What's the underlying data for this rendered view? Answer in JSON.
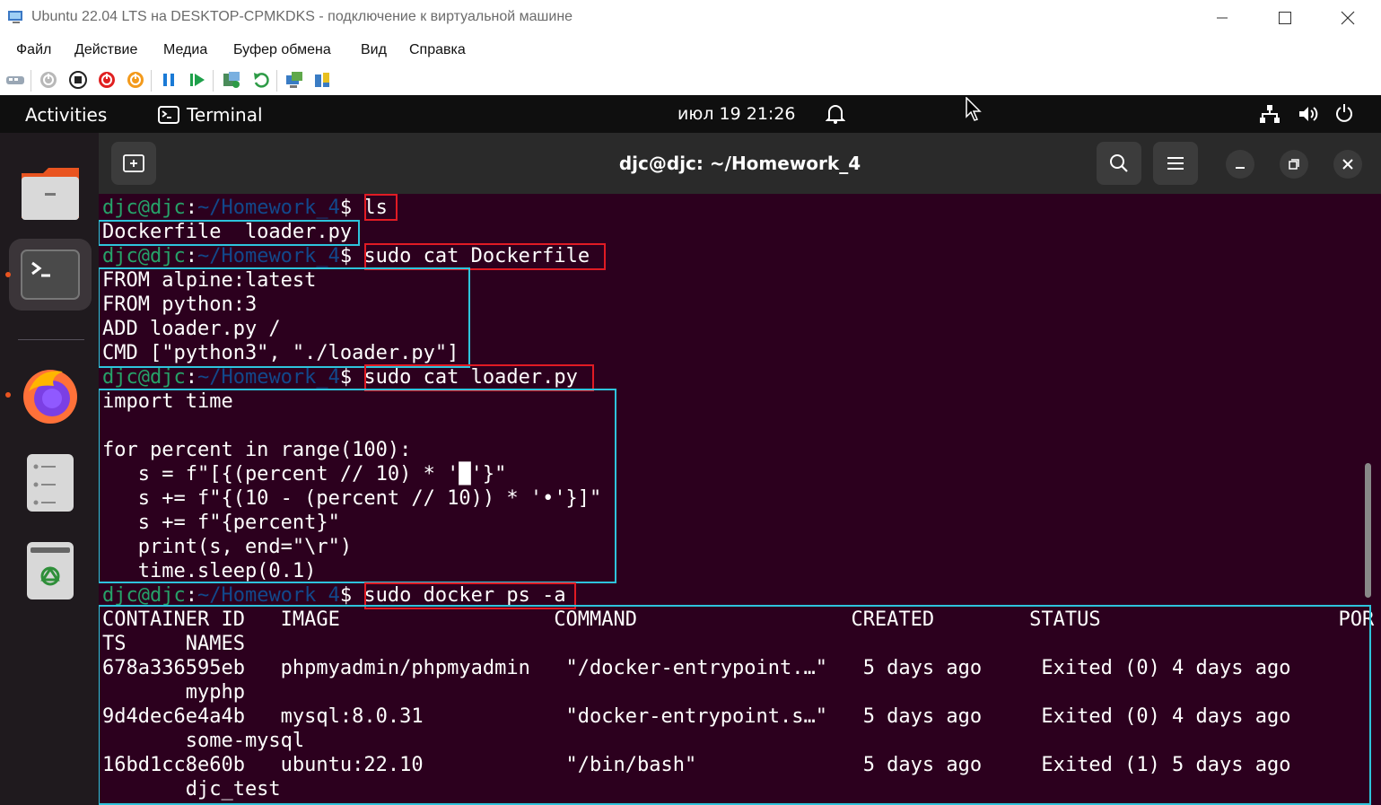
{
  "host": {
    "title": "Ubuntu 22.04 LTS на DESKTOP-CPMKDKS - подключение к виртуальной машине",
    "menu": [
      "Файл",
      "Действие",
      "Медиа",
      "Буфер обмена",
      "Вид",
      "Справка"
    ],
    "toolbar_icons": [
      "ctrl-alt-del-icon",
      "start-icon",
      "turn-off-icon",
      "shutdown-icon",
      "save-icon",
      "pause-icon",
      "resume-icon",
      "checkpoint-icon",
      "revert-icon",
      "enhanced-session-icon",
      "share-icon"
    ]
  },
  "topbar": {
    "activities": "Activities",
    "app_name": "Terminal",
    "clock": "июл 19  21:26"
  },
  "dock": {
    "items": [
      "files-icon",
      "terminal-icon",
      "firefox-icon",
      "libreoffice-icon",
      "trash-icon"
    ]
  },
  "terminal": {
    "title": "djc@djc: ~/Homework_4",
    "prompt": {
      "user_host": "djc@djc",
      "colon": ":",
      "path": "~/Homework_4",
      "dollar": "$"
    },
    "lines": {
      "cmd1": "ls",
      "out1": "Dockerfile  loader.py",
      "cmd2": "sudo cat Dockerfile",
      "df1": "FROM alpine:latest",
      "df2": "FROM python:3",
      "df3": "ADD loader.py /",
      "df4": "CMD [\"python3\", \"./loader.py\"]",
      "cmd3": "sudo cat loader.py",
      "py1": "import time",
      "py2": "",
      "py3": "for percent in range(100):",
      "py4": "   s = f\"[{(percent // 10) * '█'}\"",
      "py5": "   s += f\"{(10 - (percent // 10)) * '•'}]\"",
      "py6": "   s += f\"{percent}\"",
      "py7": "   print(s, end=\"\\r\")",
      "py8": "   time.sleep(0.1)",
      "cmd4": "sudo docker ps -a",
      "ps_h1": "CONTAINER ID   IMAGE                  COMMAND                  CREATED        STATUS                    POR",
      "ps_h2": "TS     NAMES",
      "ps_r1a": "678a336595eb   phpmyadmin/phpmyadmin   \"/docker-entrypoint.…\"   5 days ago     Exited (0) 4 days ago",
      "ps_r1b": "       myphp",
      "ps_r2a": "9d4dec6e4a4b   mysql:8.0.31            \"docker-entrypoint.s…\"   5 days ago     Exited (0) 4 days ago",
      "ps_r2b": "       some-mysql",
      "ps_r3a": "16bd1cc8e60b   ubuntu:22.10            \"/bin/bash\"              5 days ago     Exited (1) 5 days ago",
      "ps_r3b": "       djc_test"
    }
  },
  "colors": {
    "terminal_bg": "#2c001e",
    "prompt_green": "#26a269",
    "prompt_blue": "#12488b",
    "highlight_red": "#e01b24",
    "highlight_cyan": "#2ec4dc"
  }
}
